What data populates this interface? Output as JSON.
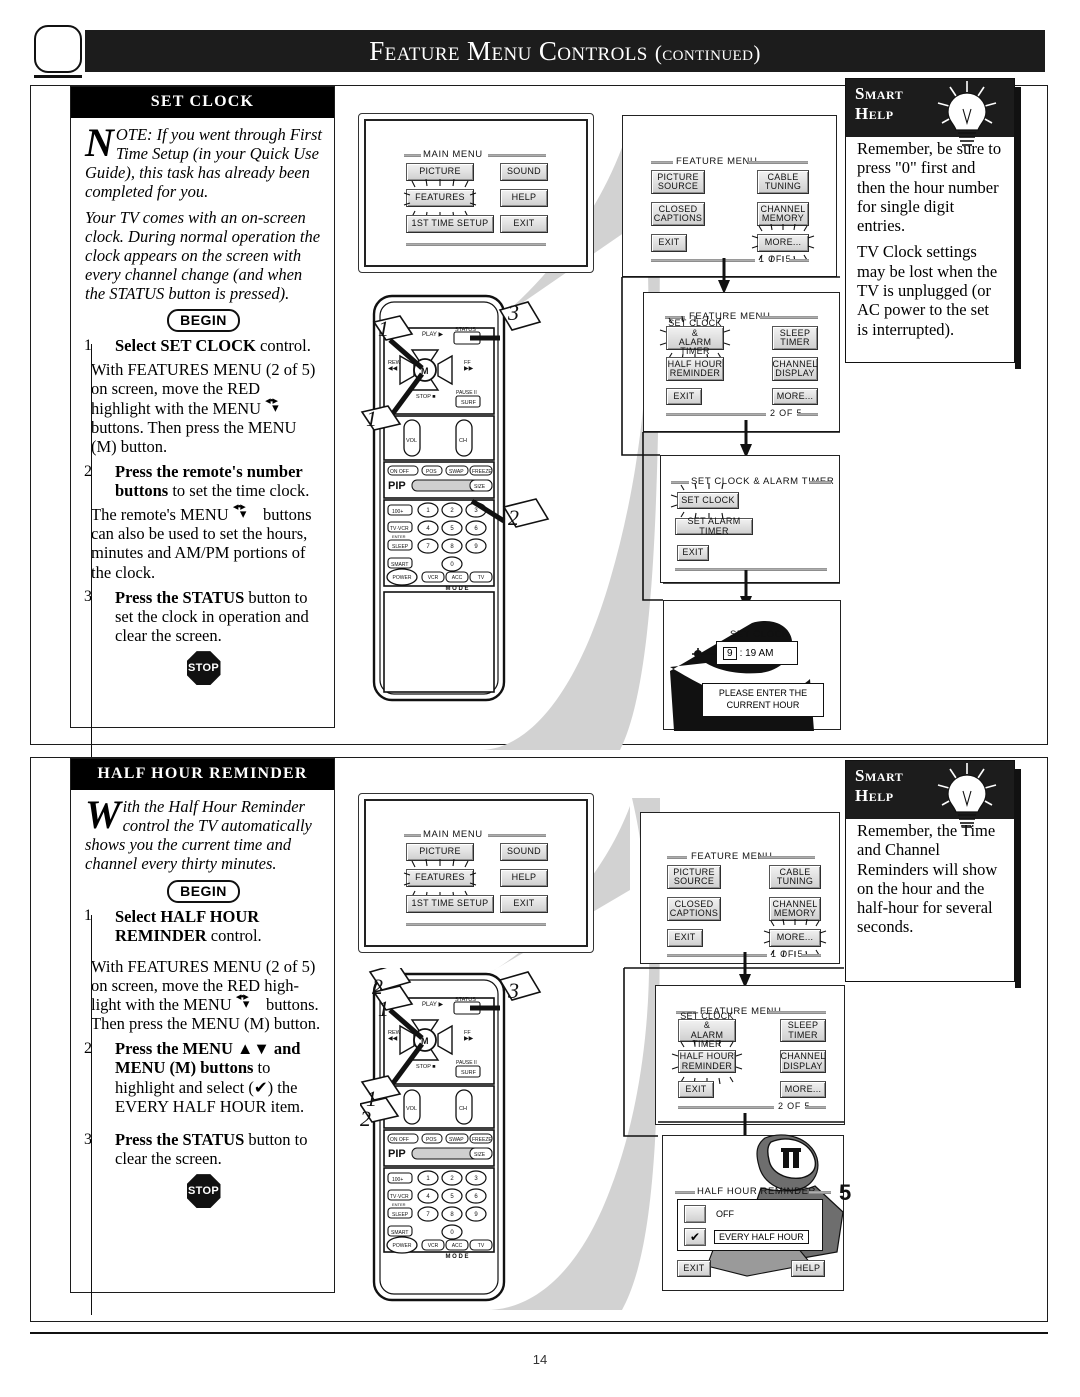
{
  "page": {
    "title_main": "Feature Menu Controls",
    "title_suffix": "(continued)",
    "folio": "14"
  },
  "section_setclock": {
    "header": "SET CLOCK",
    "intro_dropcap": "N",
    "intro_rest": "OTE: If you went through First Time Setup (in your Quick Use Guide), this task has already been completed for you.",
    "intro2": "Your TV comes with an on-screen clock. During normal operation the clock appears on the screen with every channel change (and when the STATUS button is pressed).",
    "begin_label": "BEGIN",
    "step1_num": "1",
    "step1_bold": "Select SET CLOCK",
    "step1_rest": " control.",
    "step1_para_a": "With FEATURES MENU (2 of 5) on screen, move the RED highlight with the MENU",
    "step1_para_b": "buttons. Then press the MENU (M) button.",
    "step2_num": "2",
    "step2_bold": "Press the remote's number buttons",
    "step2_rest": " to set the time clock.",
    "step2_para_a": "The remote's MENU",
    "step2_para_b": "buttons can also be used to set the hours, minutes and AM/PM portions of the clock.",
    "step3_num": "3",
    "step3_bold": "Press the STATUS",
    "step3_rest": " button to set the clock in operation and clear the screen.",
    "stop_label": "STOP"
  },
  "section_halfhour": {
    "header": "HALF HOUR REMINDER",
    "intro_dropcap": "W",
    "intro_rest": "ith the Half Hour Reminder control the TV automatically shows you the current time and channel every thirty minutes.",
    "begin_label": "BEGIN",
    "step1_num": "1",
    "step1_bold": "Select HALF HOUR REMINDER",
    "step1_rest": " control.",
    "step1_para_a": "With FEATURES MENU (2 of 5) on screen, move the RED high-light with the MENU",
    "step1_para_b": "buttons. Then press the MENU (M) button.",
    "step2_num": "2",
    "step2_bold_a": "Press the MENU ▲▼ and MENU (M) buttons",
    "step2_rest": " to highlight and select (✔) the EVERY HALF HOUR item.",
    "step3_num": "3",
    "step3_bold": "Press the STATUS",
    "step3_rest": " button to clear the screen.",
    "stop_label": "STOP"
  },
  "smart_help_top": {
    "line1": "Smart",
    "line2": "Help",
    "p1": "Remember, be sure to press \"0\" first and then the hour number for single digit entries.",
    "p2": "TV Clock settings may be lost when the TV is unplugged (or AC power to the set is interrupted)."
  },
  "smart_help_bottom": {
    "line1": "Smart",
    "line2": "Help",
    "p1": "Remember, the Time and Channel Reminders will show on the hour and the half-hour for several seconds."
  },
  "screens": {
    "main_menu": {
      "title": "MAIN MENU",
      "buttons": [
        {
          "label": "PICTURE",
          "highlighted": false
        },
        {
          "label": "SOUND",
          "highlighted": false
        },
        {
          "label": "FEATURES",
          "highlighted": true
        },
        {
          "label": "HELP",
          "highlighted": false
        },
        {
          "label": "1ST TIME SETUP",
          "highlighted": false
        },
        {
          "label": "EXIT",
          "highlighted": false
        }
      ]
    },
    "feature_menu_1": {
      "title": "FEATURE MENU",
      "pageno": "1 OF 5",
      "buttons": [
        {
          "label": "PICTURE\nSOURCE",
          "highlighted": false
        },
        {
          "label": "CABLE\nTUNING",
          "highlighted": false
        },
        {
          "label": "CLOSED\nCAPTIONS",
          "highlighted": false
        },
        {
          "label": "CHANNEL\nMEMORY",
          "highlighted": false
        },
        {
          "label": "EXIT",
          "highlighted": false
        },
        {
          "label": "MORE...",
          "highlighted": true
        }
      ]
    },
    "feature_menu_2_clock": {
      "title": "FEATURE MENU",
      "pageno": "2 OF 5",
      "buttons": [
        {
          "label": "SET CLOCK &\nALARM TIMER",
          "highlighted": true
        },
        {
          "label": "SLEEP\nTIMER",
          "highlighted": false
        },
        {
          "label": "HALF HOUR\nREMINDER",
          "highlighted": false
        },
        {
          "label": "CHANNEL\nDISPLAY",
          "highlighted": false
        },
        {
          "label": "EXIT",
          "highlighted": false
        },
        {
          "label": "MORE...",
          "highlighted": false
        }
      ]
    },
    "set_clock_alarm": {
      "title": "SET CLOCK & ALARM TIMER",
      "buttons": [
        {
          "label": "SET CLOCK",
          "highlighted": true
        },
        {
          "label": "SET ALARM TIMER",
          "highlighted": false
        },
        {
          "label": "EXIT",
          "highlighted": false
        }
      ]
    },
    "set_clock_entry": {
      "title": "SET CLOCK",
      "time_hour": "9",
      "time_rest": ": 19 AM",
      "prompt_line1": "PLEASE ENTER THE",
      "prompt_line2": "CURRENT HOUR"
    },
    "feature_menu_1_b": {
      "title": "FEATURE MENU",
      "pageno": "1 OF 5",
      "buttons": [
        {
          "label": "PICTURE\nSOURCE",
          "highlighted": false
        },
        {
          "label": "CABLE\nTUNING",
          "highlighted": false
        },
        {
          "label": "CLOSED\nCAPTIONS",
          "highlighted": false
        },
        {
          "label": "CHANNEL\nMEMORY",
          "highlighted": false
        },
        {
          "label": "EXIT",
          "highlighted": false
        },
        {
          "label": "MORE...",
          "highlighted": true
        }
      ]
    },
    "feature_menu_2_half": {
      "title": "FEATURE MENU",
      "pageno": "2 OF 5",
      "buttons": [
        {
          "label": "SET CLOCK &\nALARM TIMER",
          "highlighted": false
        },
        {
          "label": "SLEEP\nTIMER",
          "highlighted": false
        },
        {
          "label": "HALF HOUR\nREMINDER",
          "highlighted": true
        },
        {
          "label": "CHANNEL\nDISPLAY",
          "highlighted": false
        },
        {
          "label": "EXIT",
          "highlighted": false
        },
        {
          "label": "MORE...",
          "highlighted": false
        }
      ]
    },
    "half_hour_reminder": {
      "title": "HALF HOUR REMINDER",
      "option_off": "OFF",
      "option_every": "EVERY HALF HOUR",
      "check_glyph": "✔",
      "exit": "EXIT",
      "help": "HELP"
    }
  },
  "remote": {
    "play": "PLAY ▶",
    "status": "STATUS",
    "rew": "REW",
    "rew_sym": "◀◀",
    "ff": "FF",
    "ff_sym": "▶▶",
    "stop": "STOP ■",
    "pause": "PAUSE II",
    "surf": "SURF",
    "menu_center": "M",
    "vol": "VOL",
    "ch": "CH",
    "pip": "PIP",
    "pip_onoff": "ON  OFF",
    "pip_pos": "POS",
    "pip_swap": "SWAP",
    "pip_freeze": "FREEZE",
    "pip_size": "SIZE",
    "k100": "100+",
    "tvvcr": "TV·VCR",
    "enter": "ENTER",
    "sleep": "SLEEP",
    "smart": "SMART",
    "power": "POWER",
    "keys": [
      "1",
      "2",
      "3",
      "4",
      "5",
      "6",
      "7",
      "8",
      "9",
      "0"
    ],
    "mode_vcr": "VCR",
    "mode_acc": "ACC",
    "mode_tv": "TV",
    "mode_word": "M  O  D  E"
  },
  "callouts": {
    "one": "1",
    "two": "2",
    "three": "3"
  },
  "colors": {
    "ink": "#111111",
    "header_bg": "#1c1c1c",
    "swoosh": "#d2d2d2",
    "button_face": "#dcdcdc"
  }
}
